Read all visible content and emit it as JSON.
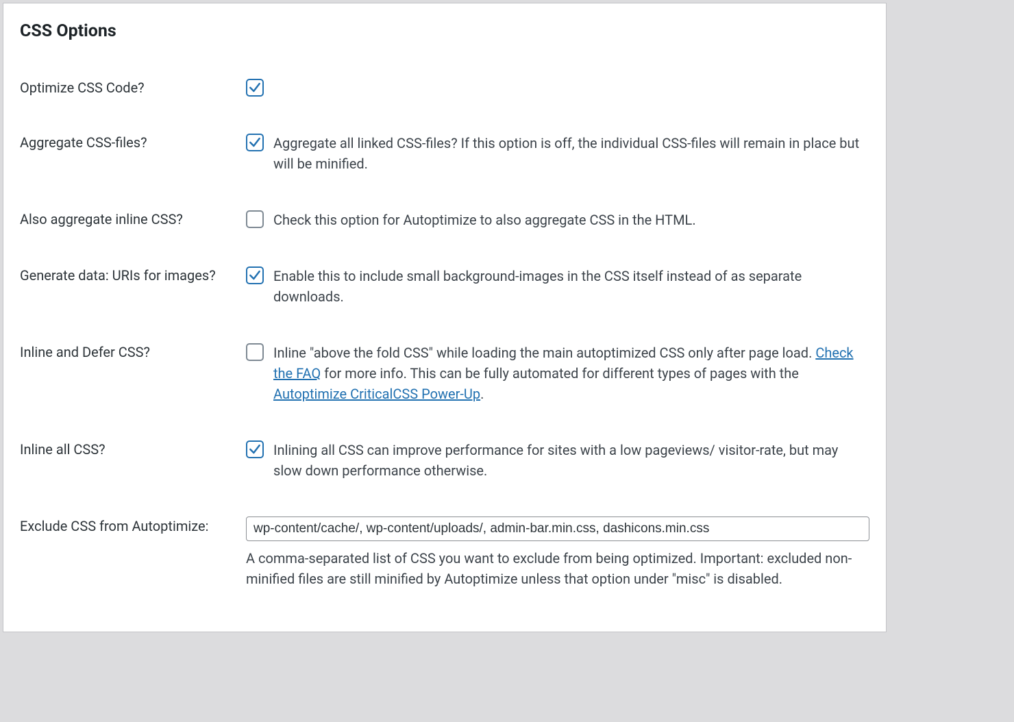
{
  "section_title": "CSS Options",
  "rows": {
    "optimize": {
      "label": "Optimize CSS Code?",
      "checked": true
    },
    "aggregate": {
      "label": "Aggregate CSS-files?",
      "checked": true,
      "desc": "Aggregate all linked CSS-files? If this option is off, the individual CSS-files will remain in place but will be minified."
    },
    "aggregate_inline": {
      "label": "Also aggregate inline CSS?",
      "checked": false,
      "desc": "Check this option for Autoptimize to also aggregate CSS in the HTML."
    },
    "data_uris": {
      "label": "Generate data: URIs for images?",
      "checked": true,
      "desc": "Enable this to include small background-images in the CSS itself instead of as separate downloads."
    },
    "inline_defer": {
      "label": "Inline and Defer CSS?",
      "checked": false,
      "desc_pre": "Inline \"above the fold CSS\" while loading the main autoptimized CSS only after page load. ",
      "link1": "Check the FAQ",
      "desc_mid": " for more info. This can be fully automated for different types of pages with the ",
      "link2": "Autoptimize CriticalCSS Power-Up",
      "desc_post": "."
    },
    "inline_all": {
      "label": "Inline all CSS?",
      "checked": true,
      "desc": "Inlining all CSS can improve performance for sites with a low pageviews/ visitor-rate, but may slow down performance otherwise."
    },
    "exclude": {
      "label": "Exclude CSS from Autoptimize:",
      "value": "wp-content/cache/, wp-content/uploads/, admin-bar.min.css, dashicons.min.css",
      "helper": "A comma-separated list of CSS you want to exclude from being optimized. Important: excluded non-minified files are still minified by Autoptimize unless that option under \"misc\" is disabled."
    }
  }
}
